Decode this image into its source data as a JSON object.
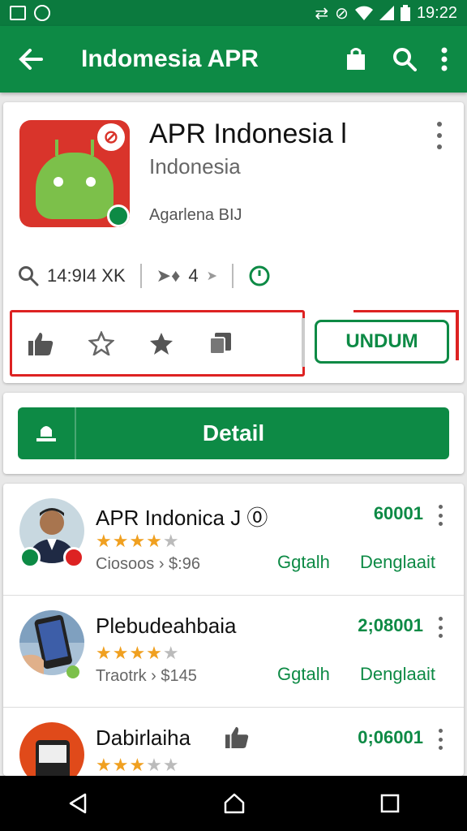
{
  "status_bar": {
    "time": "19:22"
  },
  "app_bar": {
    "title": "Indomesia APR",
    "back_icon": "arrow-left-icon",
    "icons": [
      "shopping-bag-icon",
      "search-icon",
      "more-vert-icon"
    ]
  },
  "app": {
    "name": "APR Indonesia l",
    "region": "Indonesia",
    "developer": "Agarlena BIJ",
    "stats": {
      "downloads": "14:9I4 XK",
      "rating": "4"
    },
    "action_icons": [
      "thumb-up-icon",
      "star-outline-icon",
      "star-filled-icon",
      "copy-icon"
    ],
    "download_label": "UNDUM"
  },
  "detail": {
    "label": "Detail"
  },
  "list": {
    "items": [
      {
        "name": "APR Indonica J ⓪",
        "count": "60001",
        "rating": 4,
        "price": "Ciosoos › $:96",
        "link1": "Ggtalh",
        "link2": "Denglaait",
        "avatar": "person-avatar"
      },
      {
        "name": "Plebudeahbaia",
        "count": "2;08001",
        "rating": 4,
        "price": "Traotrk › $145",
        "link1": "Ggtalh",
        "link2": "Denglaait",
        "avatar": "phone-hand-avatar"
      },
      {
        "name": "Dabirlaiha",
        "count": "0;06001",
        "rating": 3,
        "price": "",
        "link1": "",
        "link2": "",
        "avatar": "phone-red-avatar"
      }
    ]
  },
  "colors": {
    "brand_green": "#0d8a45",
    "status_green": "#0b7a3e",
    "highlight_red": "#dd2222",
    "star": "#f0a020"
  }
}
